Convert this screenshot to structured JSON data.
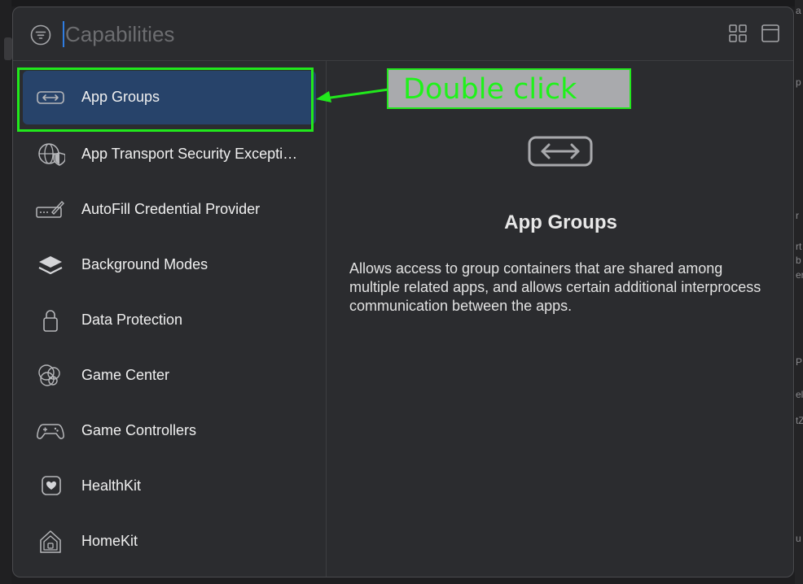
{
  "search": {
    "placeholder": "Capabilities"
  },
  "capabilities": [
    {
      "label": "App Groups",
      "icon": "app-groups-icon",
      "selected": true
    },
    {
      "label": "App Transport Security Excepti…",
      "icon": "globe-shield-icon"
    },
    {
      "label": "AutoFill Credential Provider",
      "icon": "autofill-icon"
    },
    {
      "label": "Background Modes",
      "icon": "layers-icon"
    },
    {
      "label": "Data Protection",
      "icon": "lock-icon"
    },
    {
      "label": "Game Center",
      "icon": "game-center-icon"
    },
    {
      "label": "Game Controllers",
      "icon": "gamepad-icon"
    },
    {
      "label": "HealthKit",
      "icon": "heart-icon"
    },
    {
      "label": "HomeKit",
      "icon": "home-icon"
    }
  ],
  "detail": {
    "title": "App Groups",
    "description": "Allows access to group containers that are shared among multiple related apps, and allows certain additional interprocess communication between the apps."
  },
  "annotation": {
    "callout": "Double click"
  },
  "background_fragments": [
    "a",
    "p",
    "r",
    "rt",
    "b",
    "er",
    "P",
    "el",
    "tZ",
    "u"
  ],
  "colors": {
    "selection": "#27436a",
    "annotation_green": "#21e81c",
    "caret": "#2f7de1"
  }
}
